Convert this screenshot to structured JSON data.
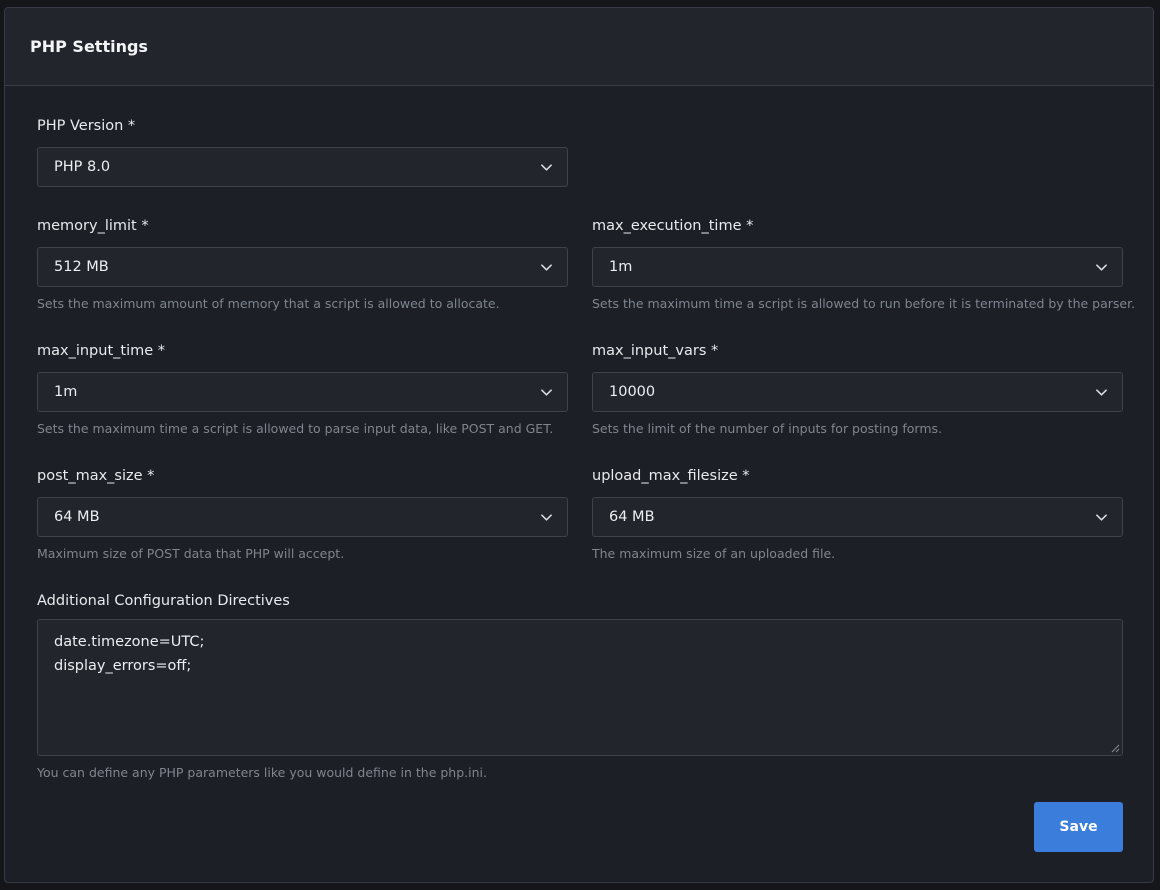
{
  "header": {
    "title": "PHP Settings"
  },
  "php_version": {
    "label": "PHP Version *",
    "value": "PHP 8.0"
  },
  "memory_limit": {
    "label": "memory_limit *",
    "value": "512 MB",
    "help": "Sets the maximum amount of memory that a script is allowed to allocate."
  },
  "max_execution_time": {
    "label": "max_execution_time *",
    "value": "1m",
    "help": "Sets the maximum time a script is allowed to run before it is terminated by the parser."
  },
  "max_input_time": {
    "label": "max_input_time *",
    "value": "1m",
    "help": "Sets the maximum time a script is allowed to parse input data, like POST and GET."
  },
  "max_input_vars": {
    "label": "max_input_vars *",
    "value": "10000",
    "help": "Sets the limit of the number of inputs for posting forms."
  },
  "post_max_size": {
    "label": "post_max_size *",
    "value": "64 MB",
    "help": "Maximum size of POST data that PHP will accept."
  },
  "upload_max_filesize": {
    "label": "upload_max_filesize *",
    "value": "64 MB",
    "help": "The maximum size of an uploaded file."
  },
  "additional_config": {
    "label": "Additional Configuration Directives",
    "lines": [
      "date.timezone=UTC;",
      "display_errors=off;"
    ],
    "help": "You can define any PHP parameters like you would define in the php.ini."
  },
  "actions": {
    "save_label": "Save"
  },
  "icons": {
    "select_arrow": "chevron-down-icon",
    "resize": "resize-grip-icon"
  },
  "colors": {
    "accent": "#3a7ddb",
    "background": "#1c1f26",
    "field_background": "#22252c"
  }
}
